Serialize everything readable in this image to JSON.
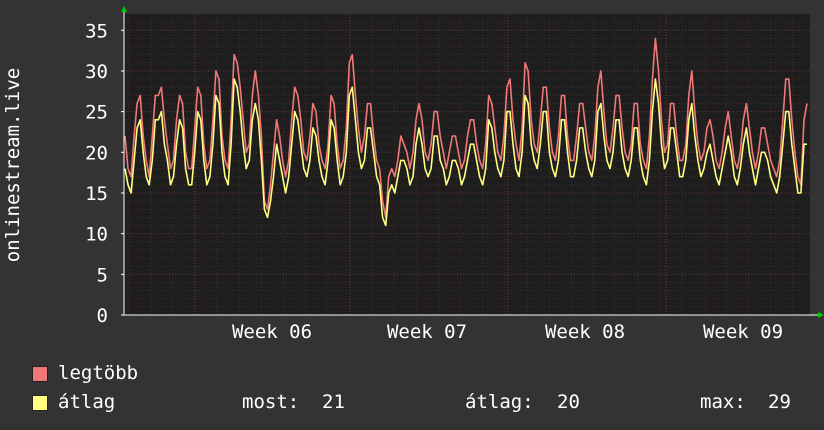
{
  "chart_data": {
    "type": "line",
    "ylabel": "onlinestream.live",
    "ylim": [
      0,
      37
    ],
    "yticks": [
      0,
      5,
      10,
      15,
      20,
      25,
      30,
      35
    ],
    "xtick_labels": [
      "Week 06",
      "Week 07",
      "Week 08",
      "Week 09"
    ],
    "grid": true,
    "colors": {
      "background": "#333333",
      "plot": "#1e1e1e",
      "grid": "#5a3a3a",
      "axis": "#ffffff"
    },
    "series": [
      {
        "name": "legtöbb",
        "color": "#f07878",
        "values": [
          22,
          18,
          17,
          22,
          26,
          27,
          22,
          19,
          17,
          22,
          27,
          27,
          28,
          24,
          21,
          18,
          19,
          24,
          27,
          26,
          20,
          18,
          18,
          23,
          28,
          27,
          21,
          18,
          19,
          24,
          30,
          29,
          22,
          19,
          18,
          24,
          32,
          31,
          28,
          24,
          20,
          21,
          27,
          30,
          27,
          22,
          14,
          13,
          16,
          20,
          24,
          22,
          19,
          17,
          19,
          24,
          28,
          27,
          24,
          20,
          19,
          22,
          26,
          25,
          21,
          19,
          18,
          21,
          27,
          26,
          21,
          18,
          19,
          23,
          31,
          32,
          27,
          23,
          20,
          22,
          26,
          26,
          22,
          19,
          18,
          14,
          12,
          17,
          18,
          17,
          19,
          22,
          21,
          20,
          18,
          20,
          24,
          26,
          24,
          20,
          19,
          21,
          25,
          25,
          22,
          20,
          18,
          20,
          22,
          22,
          20,
          18,
          19,
          22,
          24,
          24,
          21,
          19,
          18,
          21,
          27,
          26,
          23,
          20,
          19,
          22,
          28,
          29,
          24,
          21,
          19,
          23,
          31,
          30,
          24,
          21,
          20,
          24,
          28,
          28,
          23,
          20,
          19,
          22,
          27,
          27,
          22,
          19,
          19,
          22,
          26,
          26,
          23,
          20,
          19,
          22,
          28,
          30,
          25,
          21,
          20,
          23,
          27,
          27,
          23,
          20,
          19,
          21,
          26,
          26,
          21,
          19,
          18,
          22,
          29,
          34,
          30,
          24,
          20,
          21,
          26,
          26,
          22,
          19,
          19,
          21,
          27,
          30,
          25,
          21,
          19,
          20,
          23,
          24,
          22,
          19,
          18,
          20,
          23,
          25,
          22,
          19,
          18,
          20,
          24,
          26,
          23,
          20,
          18,
          20,
          23,
          23,
          21,
          19,
          18,
          17,
          19,
          24,
          29,
          29,
          24,
          20,
          17,
          16,
          24,
          26
        ]
      },
      {
        "name": "átlag",
        "color": "#ffff80",
        "values": [
          18,
          16,
          15,
          19,
          23,
          24,
          20,
          17,
          16,
          19,
          24,
          24,
          25,
          21,
          19,
          16,
          17,
          21,
          24,
          23,
          18,
          16,
          16,
          20,
          25,
          24,
          19,
          16,
          17,
          21,
          27,
          26,
          20,
          17,
          16,
          21,
          29,
          28,
          25,
          21,
          18,
          19,
          24,
          26,
          24,
          19,
          13,
          12,
          14,
          17,
          21,
          19,
          17,
          15,
          17,
          21,
          25,
          24,
          21,
          18,
          17,
          19,
          23,
          22,
          19,
          17,
          16,
          19,
          24,
          23,
          19,
          16,
          17,
          20,
          27,
          28,
          24,
          20,
          18,
          19,
          23,
          23,
          20,
          17,
          16,
          12,
          11,
          15,
          16,
          15,
          17,
          19,
          19,
          18,
          16,
          17,
          21,
          23,
          21,
          18,
          17,
          18,
          22,
          22,
          19,
          18,
          16,
          17,
          19,
          19,
          18,
          16,
          17,
          19,
          21,
          21,
          19,
          17,
          16,
          18,
          24,
          23,
          20,
          18,
          17,
          19,
          25,
          25,
          21,
          18,
          17,
          20,
          27,
          26,
          21,
          19,
          18,
          21,
          25,
          25,
          20,
          18,
          17,
          19,
          24,
          24,
          20,
          17,
          17,
          19,
          23,
          23,
          20,
          18,
          17,
          19,
          25,
          26,
          22,
          19,
          18,
          20,
          24,
          24,
          20,
          18,
          17,
          19,
          23,
          23,
          19,
          17,
          16,
          19,
          25,
          29,
          26,
          21,
          18,
          19,
          23,
          23,
          20,
          17,
          17,
          19,
          24,
          26,
          22,
          19,
          17,
          18,
          20,
          21,
          19,
          17,
          16,
          18,
          20,
          22,
          20,
          17,
          16,
          18,
          21,
          23,
          20,
          18,
          16,
          18,
          20,
          20,
          19,
          17,
          16,
          15,
          17,
          21,
          25,
          25,
          21,
          18,
          15,
          15,
          21,
          21
        ]
      }
    ]
  },
  "legend": {
    "items": [
      {
        "label": "legtöbb",
        "color": "#f07878"
      },
      {
        "label": "átlag",
        "color": "#ffff80"
      }
    ],
    "stats": {
      "most_label": "most:",
      "most_value": "21",
      "atlag_label": "átlag:",
      "atlag_value": "20",
      "max_label": "max:",
      "max_value": "29"
    }
  }
}
